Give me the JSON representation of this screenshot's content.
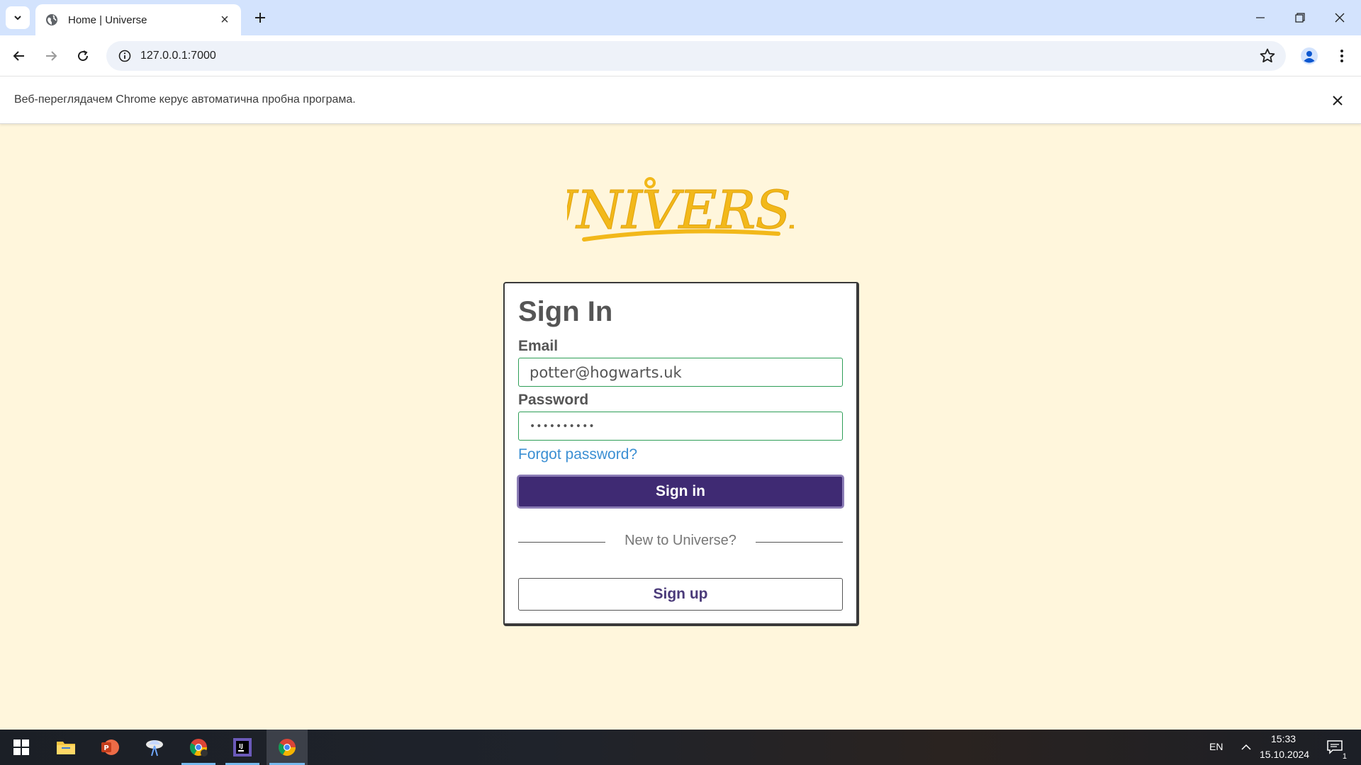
{
  "browser": {
    "tab_title": "Home | Universe",
    "url": "127.0.0.1:7000",
    "infobar_message": "Веб-переглядачем Chrome керує автоматична пробна програма."
  },
  "logo": {
    "text": "Universe"
  },
  "signin_card": {
    "title": "Sign In",
    "email_label": "Email",
    "email_value": "potter@hogwarts.uk",
    "password_label": "Password",
    "password_value": "••••••••••",
    "forgot_link": "Forgot password?",
    "signin_button": "Sign in",
    "divider_text": "New to Universe?",
    "signup_button": "Sign up"
  },
  "taskbar": {
    "language": "EN",
    "time": "15:33",
    "date": "15.10.2024",
    "notifications_count": "1"
  },
  "colors": {
    "page_bg": "#fff6dc",
    "primary_button": "#3f2a73",
    "link": "#3b8fd3",
    "input_border": "#2e9e57",
    "logo": "#f2b81a"
  }
}
